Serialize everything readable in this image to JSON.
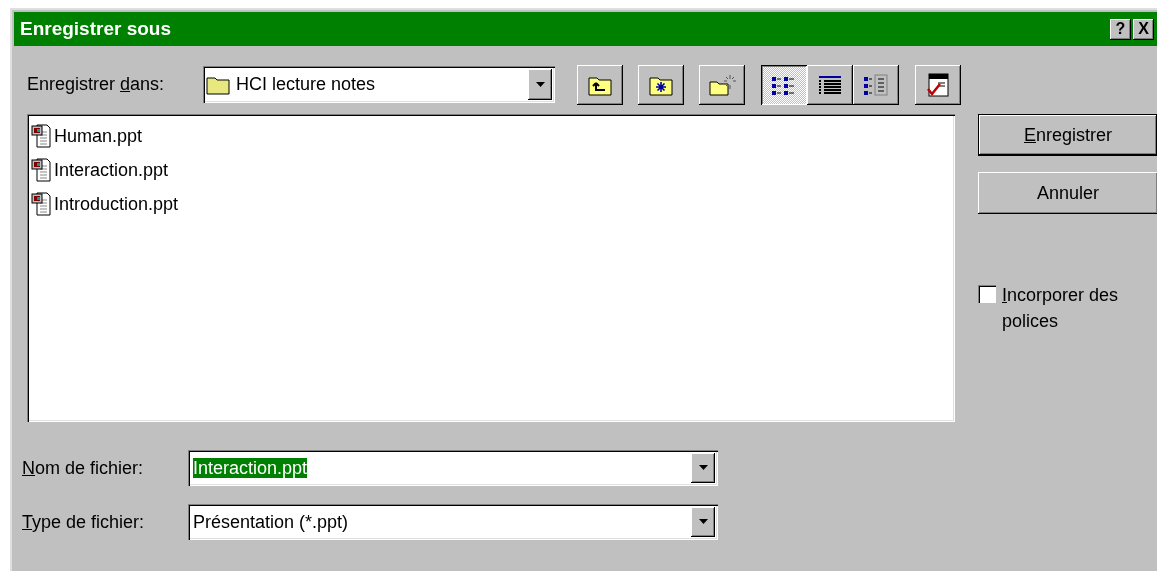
{
  "window": {
    "title": "Enregistrer sous"
  },
  "title_buttons": [
    {
      "label": "?"
    },
    {
      "label": "X"
    }
  ],
  "save_in": {
    "label": {
      "pre": "Enregistrer ",
      "key": "d",
      "post": "ans:"
    },
    "value": "HCI lecture notes"
  },
  "toolbar": [
    {
      "kind": "up-folder",
      "pressed": false
    },
    {
      "kind": "favorites-folder",
      "pressed": false
    },
    {
      "kind": "new-folder",
      "pressed": false
    },
    {
      "kind": "list-view",
      "pressed": true
    },
    {
      "kind": "details-view",
      "pressed": false
    },
    {
      "kind": "properties-view",
      "pressed": false
    },
    {
      "kind": "tools",
      "pressed": false
    }
  ],
  "files": [
    {
      "name": "Human.ppt"
    },
    {
      "name": "Interaction.ppt"
    },
    {
      "name": "Introduction.ppt"
    }
  ],
  "file_name": {
    "label": {
      "key": "N",
      "post": "om de fichier:"
    },
    "value": "Interaction.ppt",
    "highlighted": true
  },
  "file_type": {
    "label": {
      "key": "T",
      "post": "ype de fichier:"
    },
    "value": "Présentation (*.ppt)"
  },
  "buttons": [
    {
      "label": {
        "key": "E",
        "post": "nregistrer"
      },
      "default": true
    },
    {
      "label": {
        "pre": "Annuler"
      },
      "default": false
    }
  ],
  "embed_fonts": {
    "label": {
      "key": "I",
      "post": "ncorporer des polices"
    },
    "checked": false
  }
}
